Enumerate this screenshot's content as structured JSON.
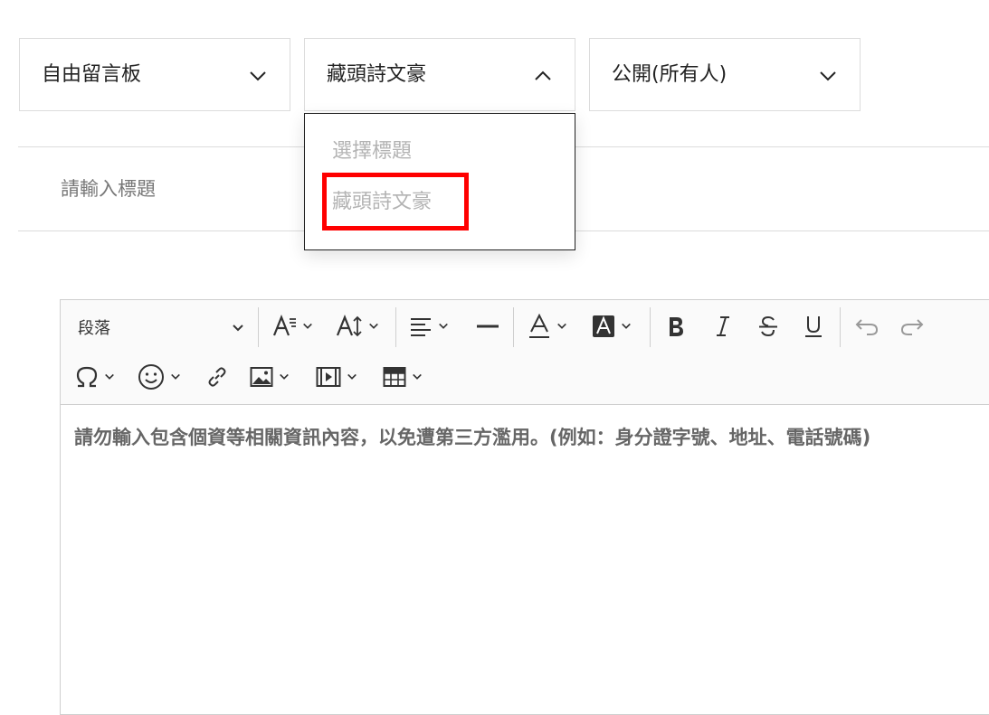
{
  "selects": {
    "board": {
      "value": "自由留言板"
    },
    "topic": {
      "value": "藏頭詩文豪"
    },
    "visibility": {
      "value": "公開(所有人)"
    }
  },
  "topic_dropdown": {
    "options": [
      "選擇標題",
      "藏頭詩文豪"
    ],
    "highlighted_option": "藏頭詩文豪",
    "highlight_color": "#ff0000"
  },
  "title_field": {
    "placeholder": "請輸入標題"
  },
  "editor": {
    "toolbar": {
      "paragraph_label": "段落",
      "icons": [
        "font-size-icon",
        "line-height-icon",
        "align-left-icon",
        "horizontal-line-icon",
        "font-color-icon",
        "background-color-icon",
        "bold-icon",
        "italic-icon",
        "strikethrough-icon",
        "underline-icon",
        "undo-icon",
        "redo-icon",
        "special-char-icon",
        "emoji-icon",
        "link-icon",
        "image-icon",
        "media-icon",
        "table-icon"
      ]
    },
    "placeholder": "請勿輸入包含個資等相關資訊內容，以免遭第三方濫用。(例如：身分證字號、地址、電話號碼)"
  }
}
